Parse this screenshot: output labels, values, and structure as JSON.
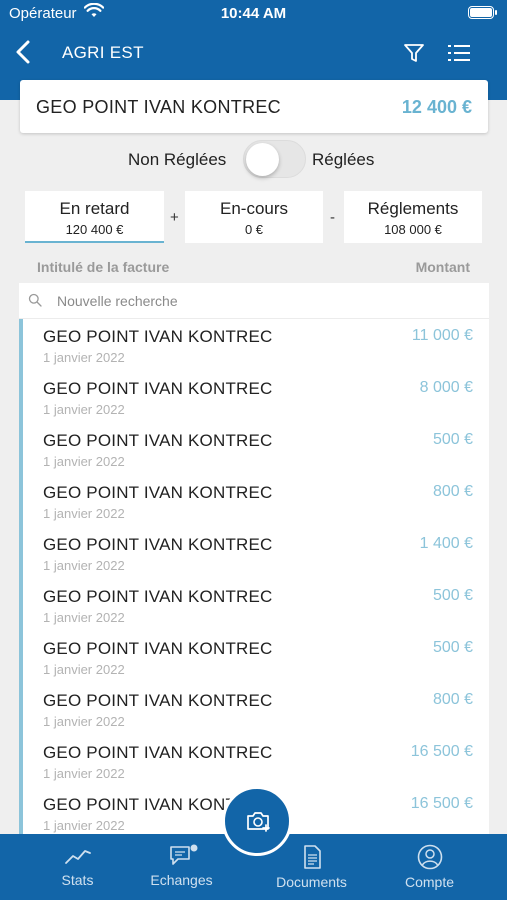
{
  "status_bar": {
    "carrier": "Opérateur",
    "time": "10:44 AM"
  },
  "nav": {
    "title": "AGRI EST"
  },
  "client": {
    "name": "GEO POINT IVAN KONTREC",
    "amount": "12 400 €"
  },
  "toggle": {
    "left_label": "Non Réglées",
    "right_label": "Réglées",
    "state": "off"
  },
  "tabs": [
    {
      "label": "En retard",
      "value": "120 400 €",
      "active": true
    },
    {
      "label": "En-cours",
      "value": "0 €",
      "active": false
    },
    {
      "label": "Réglements",
      "value": "108 000 €",
      "active": false
    }
  ],
  "operators": {
    "plus": "+",
    "minus": "-"
  },
  "columns": {
    "left": "Intitulé de la facture",
    "right": "Montant"
  },
  "search": {
    "placeholder": "Nouvelle recherche"
  },
  "invoices": [
    {
      "title": "GEO POINT IVAN KONTREC",
      "date": "1 janvier 2022",
      "amount": "11 000 €"
    },
    {
      "title": "GEO POINT IVAN KONTREC",
      "date": "1 janvier 2022",
      "amount": "8 000 €"
    },
    {
      "title": "GEO POINT IVAN KONTREC",
      "date": "1 janvier 2022",
      "amount": "500 €"
    },
    {
      "title": "GEO POINT IVAN KONTREC",
      "date": "1 janvier 2022",
      "amount": "800 €"
    },
    {
      "title": "GEO POINT IVAN KONTREC",
      "date": "1 janvier 2022",
      "amount": "1 400 €"
    },
    {
      "title": "GEO POINT IVAN KONTREC",
      "date": "1 janvier 2022",
      "amount": "500 €"
    },
    {
      "title": "GEO POINT IVAN KONTREC",
      "date": "1 janvier 2022",
      "amount": "500 €"
    },
    {
      "title": "GEO POINT IVAN KONTREC",
      "date": "1 janvier 2022",
      "amount": "800 €"
    },
    {
      "title": "GEO POINT IVAN KONTREC",
      "date": "1 janvier 2022",
      "amount": "16 500 €"
    },
    {
      "title": "GEO POINT IVAN KONTREC",
      "date": "1 janvier 2022",
      "amount": "16 500 €"
    }
  ],
  "bottom_nav": [
    {
      "label": "Stats",
      "icon": "chart-line-icon"
    },
    {
      "label": "Echanges",
      "icon": "chat-icon"
    },
    {
      "label": "Documents",
      "icon": "document-icon"
    },
    {
      "label": "Compte",
      "icon": "user-icon"
    }
  ],
  "fab": {
    "icon": "camera-add-icon"
  },
  "colors": {
    "primary": "#1265a8",
    "accent": "#69b3d1",
    "amount": "#8cc4da",
    "background": "#efefef"
  }
}
